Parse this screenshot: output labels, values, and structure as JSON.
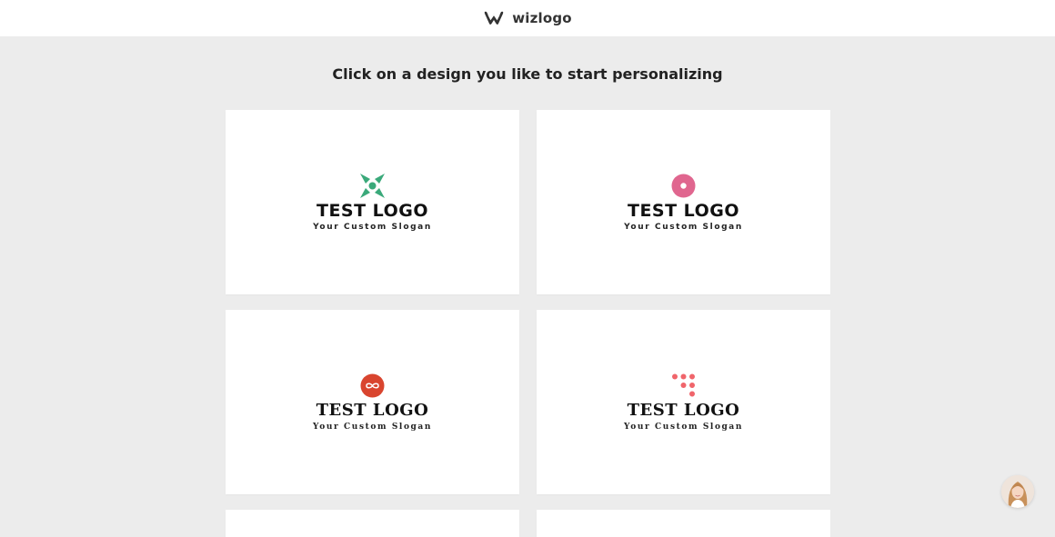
{
  "header": {
    "brand_name": "wizlogo",
    "brand_icon": "wizlogo-mark-icon"
  },
  "main": {
    "headline": "Click on a design you like to start personalizing"
  },
  "designs": [
    {
      "title": "TEST LOGO",
      "slogan": "Your Custom Slogan",
      "icon": "x-diamond-icon",
      "icon_color": "#3aa97a"
    },
    {
      "title": "TEST LOGO",
      "slogan": "Your Custom Slogan",
      "icon": "ring-dot-icon",
      "icon_color": "#e0668f"
    },
    {
      "title": "TEST LOGO",
      "slogan": "Your Custom Slogan",
      "icon": "infinity-circle-icon",
      "icon_color": "#d9452f"
    },
    {
      "title": "TEST LOGO",
      "slogan": "Your Custom Slogan",
      "icon": "dot-grid-icon",
      "icon_color": "#f0656b"
    }
  ],
  "support": {
    "avatar_icon": "support-agent-avatar"
  }
}
